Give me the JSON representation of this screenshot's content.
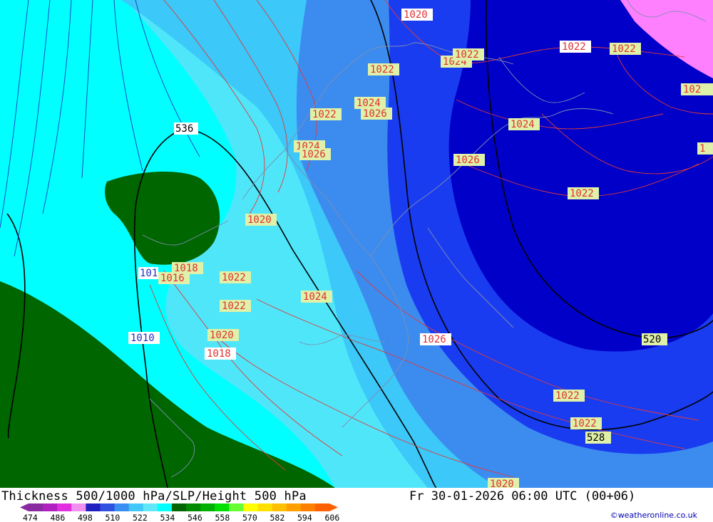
{
  "footer": {
    "title": "Thickness 500/1000 hPa/SLP/Height 500 hPa",
    "timestamp": "Fr 30-01-2026 06:00 UTC (00+06)",
    "credit": "©weatheronline.co.uk"
  },
  "scale": {
    "ticks": [
      "474",
      "486",
      "498",
      "510",
      "522",
      "534",
      "546",
      "558",
      "570",
      "582",
      "594",
      "606"
    ],
    "colors": [
      "#8a2aa0",
      "#b020c0",
      "#e030e0",
      "#f090f0",
      "#2020c0",
      "#3050e0",
      "#3a90f0",
      "#40c8f8",
      "#60e8f8",
      "#00ffff",
      "#006400",
      "#008a00",
      "#00b000",
      "#00e000",
      "#66ff33",
      "#ffff00",
      "#ffe000",
      "#ffc000",
      "#ffa000",
      "#ff8000",
      "#ff6000"
    ]
  },
  "map": {
    "colors": {
      "navy": "#0000c8",
      "blue": "#1a3cf0",
      "mid_blue": "#3c8cf0",
      "sky": "#3cc8f8",
      "light_cyan": "#50e6fa",
      "cyan": "#00ffff",
      "green": "#006600",
      "magenta": "#ff80ff",
      "land": "#ffffff",
      "slp_isobar": "#e03030",
      "height_contour": "#000000"
    },
    "slp_labels": [
      "1020",
      "1022",
      "1022",
      "1022",
      "102",
      "1024",
      "1022",
      "1022",
      "1024",
      "1026",
      "1022",
      "1024",
      "1026",
      "1026",
      "1022",
      "1020",
      "1018",
      "1016",
      "101",
      "1022",
      "1022",
      "1024",
      "1026",
      "1010",
      "1020",
      "1018",
      "1024",
      "1022",
      "1020",
      "1"
    ],
    "height_labels": [
      "536",
      "520",
      "528"
    ]
  }
}
